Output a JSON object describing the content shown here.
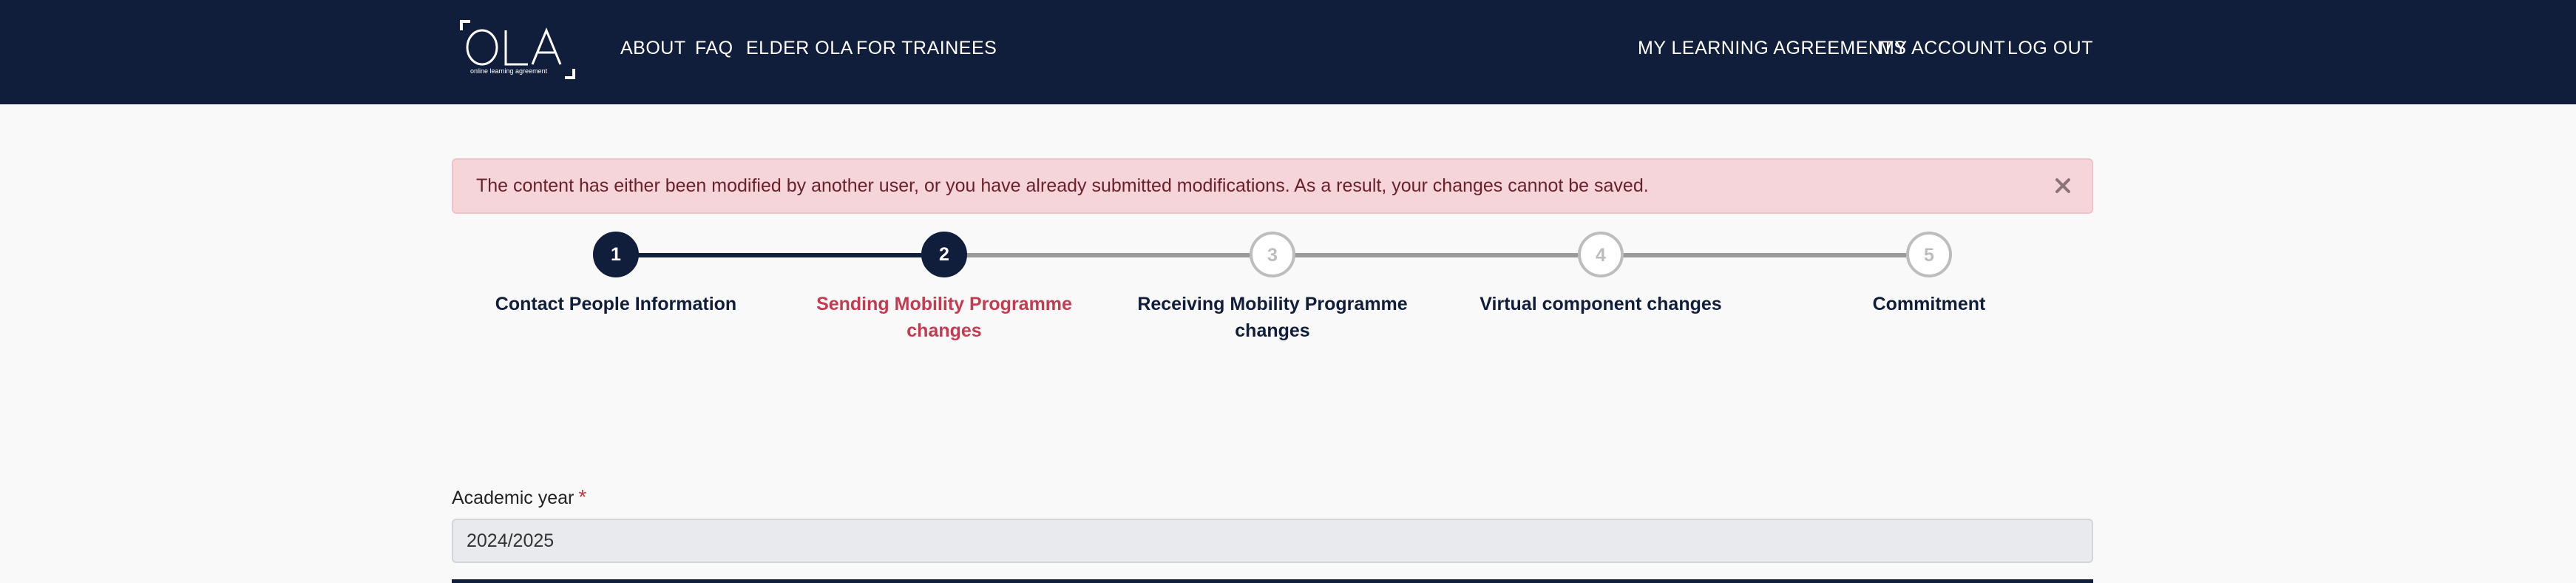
{
  "header": {
    "logo": {
      "text": "OLA",
      "tagline": "online learning agreement",
      "icon": "ola-logo"
    },
    "nav_left": [
      "ABOUT",
      "FAQ",
      "ELDER OLA",
      "FOR TRAINEES"
    ],
    "nav_right": [
      "MY LEARNING AGREEMENTS",
      "MY ACCOUNT",
      "LOG OUT"
    ]
  },
  "alert": {
    "message": "The content has either been modified by another user, or you have already submitted modifications. As a result, your changes cannot be saved.",
    "close_icon": "close-icon"
  },
  "stepper": {
    "steps": [
      {
        "number": "1",
        "label": "Contact People Information",
        "state": "done"
      },
      {
        "number": "2",
        "label": "Sending Mobility Programme changes",
        "state": "current"
      },
      {
        "number": "3",
        "label": "Receiving Mobility Programme changes",
        "state": "todo"
      },
      {
        "number": "4",
        "label": "Virtual component changes",
        "state": "todo"
      },
      {
        "number": "5",
        "label": "Commitment",
        "state": "todo"
      }
    ]
  },
  "form": {
    "academic_year": {
      "label": "Academic year",
      "required_mark": "*",
      "value": "2024/2025"
    }
  },
  "colors": {
    "navy": "#111e3b",
    "active_step_text": "#c63a4f",
    "alert_bg": "#f5d5d9",
    "pending_grey": "#bdbdbd"
  }
}
